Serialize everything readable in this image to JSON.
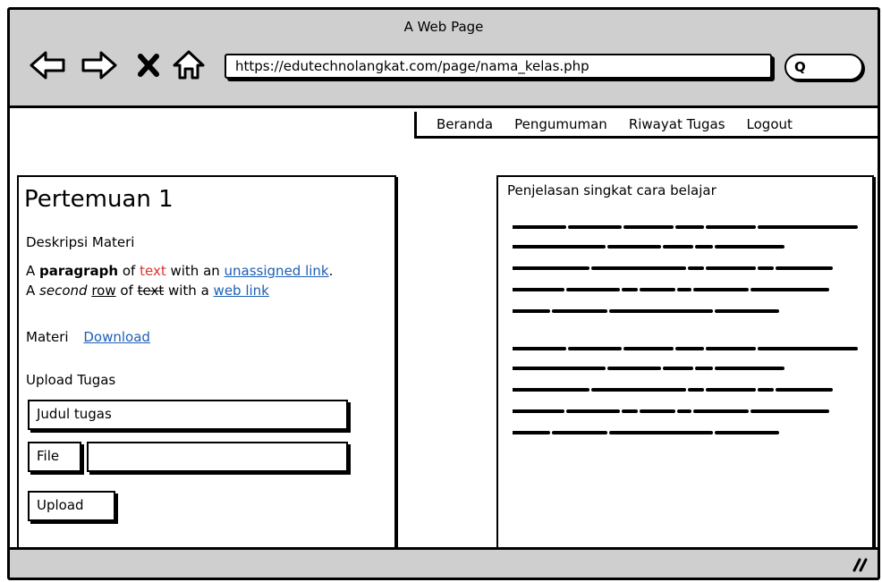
{
  "window": {
    "title": "A Web Page"
  },
  "toolbar": {
    "back_icon": "back-arrow-icon",
    "forward_icon": "forward-arrow-icon",
    "stop_icon": "close-icon",
    "home_icon": "home-icon",
    "url": "https://edutechnolangkat.com/page/nama_kelas.php",
    "search_icon": "search-icon"
  },
  "menu": {
    "items": [
      "Beranda",
      "Pengumuman",
      "Riwayat Tugas",
      "Logout"
    ]
  },
  "left": {
    "title": "Pertemuan 1",
    "desc_label": "Deskripsi Materi",
    "p1": {
      "a": "A ",
      "b": "paragraph",
      "c": " of ",
      "d": "text",
      "e": " with an ",
      "f": "unassigned link",
      "g": "."
    },
    "p2": {
      "a": "A ",
      "b": "second",
      "c": " ",
      "d": "row",
      "e": " of ",
      "f": "text",
      "g": " with a ",
      "h": "web link"
    },
    "materi_label": "Materi",
    "download_link": "Download",
    "upload_heading": "Upload Tugas",
    "judul_value": "Judul tugas",
    "file_button": "File",
    "file_value": "",
    "upload_button": "Upload"
  },
  "right": {
    "title": "Penjelasan singkat cara belajar"
  },
  "colors": {
    "chrome": "#cfcfcf",
    "link": "#1e5fb3",
    "red_text": "#e03030"
  }
}
